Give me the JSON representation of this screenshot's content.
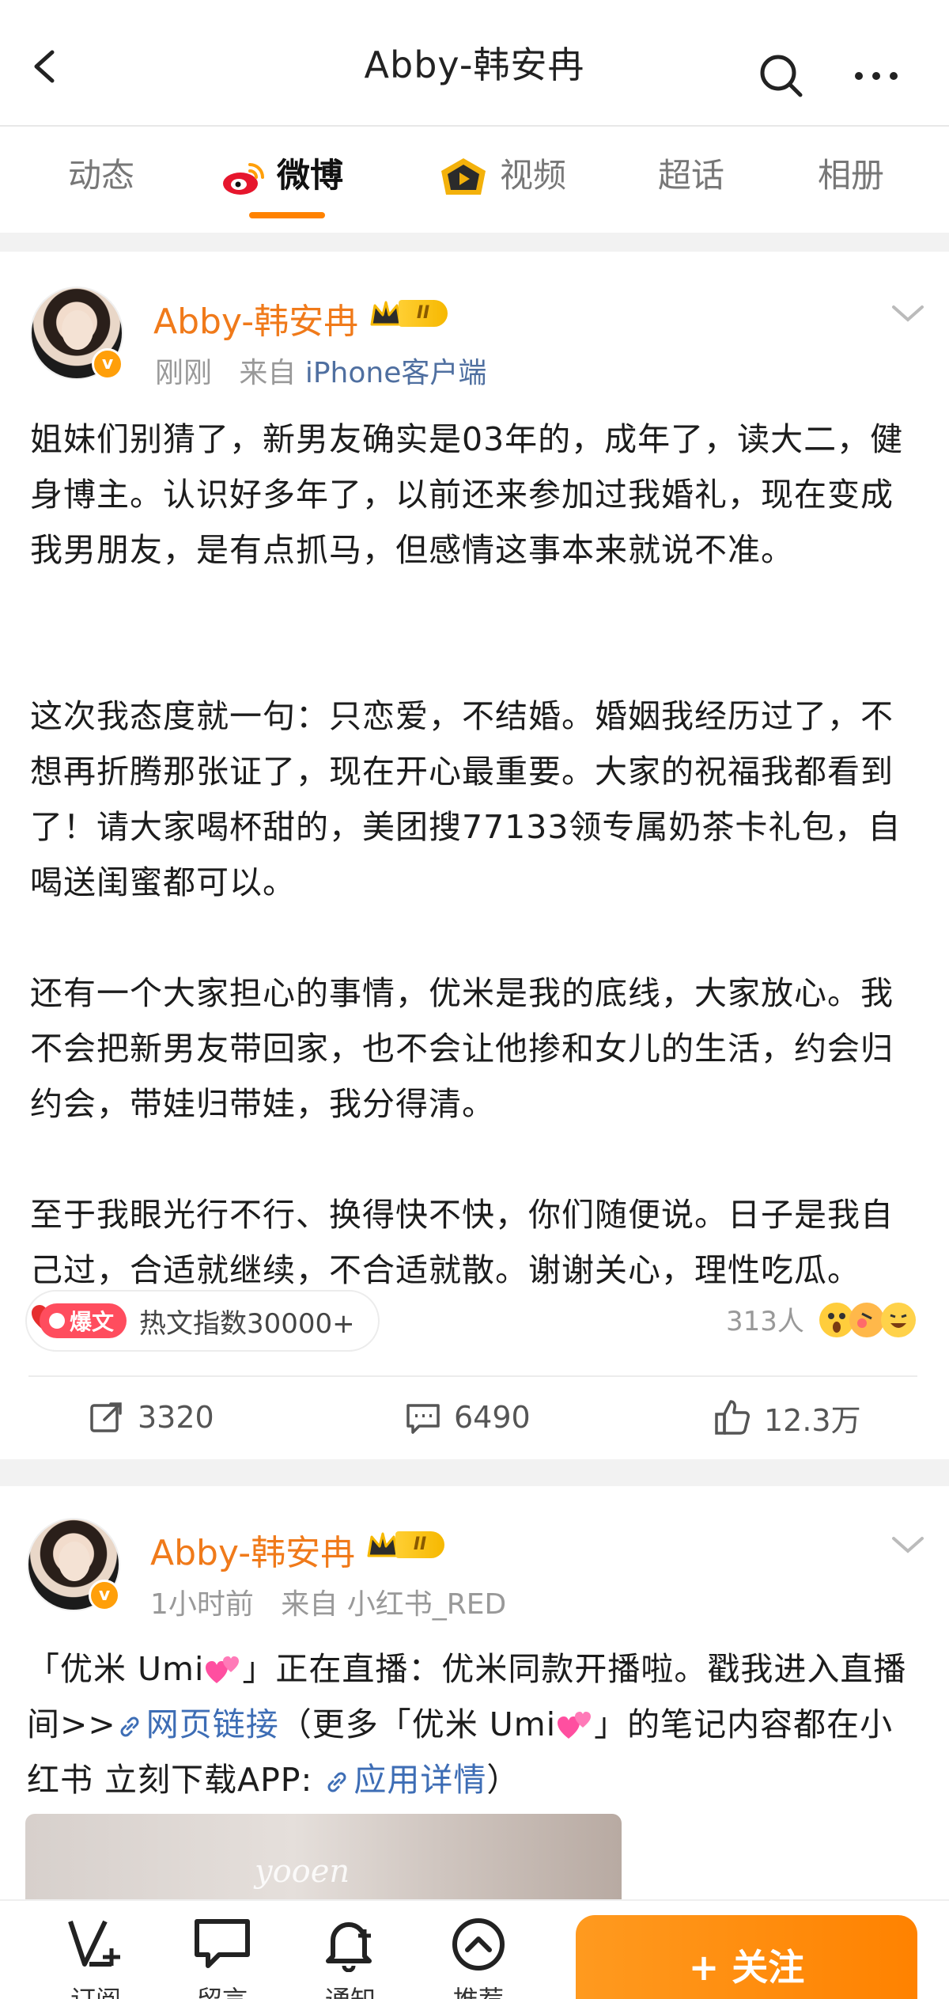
{
  "header": {
    "title": "Abby-韩安冉"
  },
  "tabs": [
    {
      "label": "动态"
    },
    {
      "label": "微博"
    },
    {
      "label": "视频"
    },
    {
      "label": "超话"
    },
    {
      "label": "相册"
    }
  ],
  "active_tab": "微博",
  "posts": [
    {
      "author": "Abby-韩安冉",
      "level": "II",
      "time": "刚刚",
      "source_prefix": "来自",
      "source": "iPhone客户端",
      "paragraphs": [
        "姐妹们别猜了，新男友确实是03年的，成年了，读大二，健身博主。认识好多年了，以前还来参加过我婚礼，现在变成我男朋友，是有点抓马，但感情这事本来就说不准。",
        "这次我态度就一句：只恋爱，不结婚。婚姻我经历过了，不想再折腾那张证了，现在开心最重要。大家的祝福我都看到了！请大家喝杯甜的，美团搜77133领专属奶茶卡礼包，自喝送闺蜜都可以。",
        "还有一个大家担心的事情，优米是我的底线，大家放心。我不会把新男友带回家，也不会让他掺和女儿的生活，约会归约会，带娃归带娃，我分得清。",
        "至于我眼光行不行、换得快不快，你们随便说。日子是我自己过，合适就继续，不合适就散。谢谢关心，理性吃瓜。"
      ],
      "hot_tag": "爆文",
      "hot_text": "热文指数30000+",
      "reactions": "313人",
      "reposts": "3320",
      "comments": "6490",
      "likes": "12.3万"
    },
    {
      "author": "Abby-韩安冉",
      "level": "II",
      "time": "1小时前",
      "source_prefix": "来自",
      "source": "小红书_RED",
      "text_a": "「优米 Umi",
      "text_b": "」正在直播：优米同款开播啦。戳我进入直播间>>",
      "link_1": "网页链接",
      "text_c": "（更多「优米 Umi",
      "text_d": "」的笔记内容都在小红书 立刻下载APP: ",
      "link_2": "应用详情",
      "text_e": "）",
      "image_watermark": "yooen"
    }
  ],
  "bottom_bar": {
    "items": [
      {
        "label": "订阅",
        "icon": "subscribe-icon"
      },
      {
        "label": "留言",
        "icon": "comment-bubble-icon"
      },
      {
        "label": "通知",
        "icon": "bell-icon"
      },
      {
        "label": "推荐",
        "icon": "chevron-up-circle-icon"
      }
    ],
    "follow_label": "+ 关注"
  },
  "colors": {
    "accent": "#ff8200",
    "name": "#f07a1a",
    "link": "#3d6db5",
    "hot": "#ff4d5e"
  }
}
